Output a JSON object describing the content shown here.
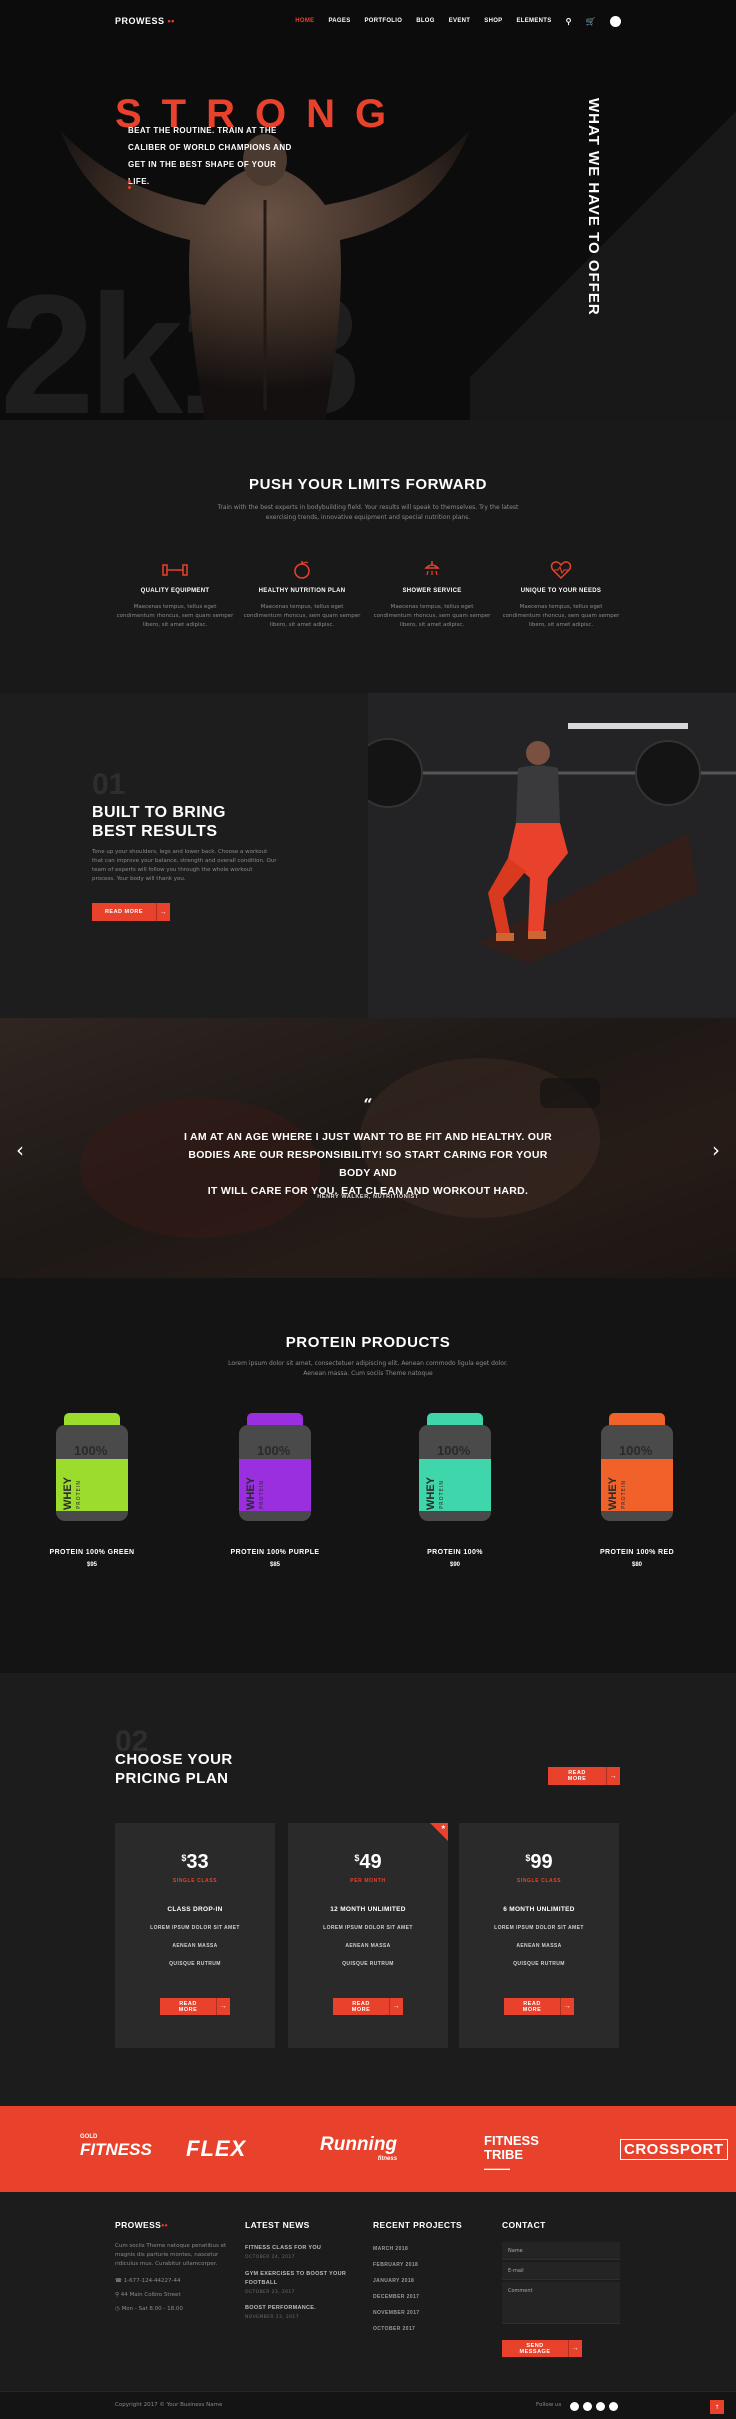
{
  "header": {
    "logo": "PROWESS",
    "logo_dots": "••",
    "menu": [
      "HOME",
      "PAGES",
      "PORTFOLIO",
      "BLOG",
      "EVENT",
      "SHOP",
      "ELEMENTS"
    ]
  },
  "hero": {
    "headline": "STRONG",
    "tagline": [
      "BEAT THE ROUTINE. TRAIN AT THE",
      "CALIBER OF WORLD CHAMPIONS AND",
      "GET IN THE BEST SHAPE OF YOUR LIFE."
    ],
    "background_text": "2k18",
    "side_text": "WHAT WE HAVE TO OFFER"
  },
  "features": {
    "title": "PUSH YOUR LIMITS FORWARD",
    "subtitle": [
      "Train with the best experts in bodybuilding field. Your results will speak to themselves. Try the latest",
      "exercising trends, innovative equipment and special nutrition plans."
    ],
    "items": [
      {
        "title": "QUALITY EQUIPMENT",
        "icon": "dumbbell-icon",
        "text": [
          "Maecenas tempus, tellus eget",
          "condimentum rhoncus, sem quam semper",
          "libero, sit amet adipisc."
        ]
      },
      {
        "title": "HEALTHY NUTRITION PLAN",
        "icon": "nutrition-icon",
        "text": [
          "Maecenas tempus, tellus eget",
          "condimentum rhoncus, sem quam semper",
          "libero, sit amet adipisc."
        ]
      },
      {
        "title": "SHOWER SERVICE",
        "icon": "shower-icon",
        "text": [
          "Maecenas tempus, tellus eget",
          "condimentum rhoncus, sem quam semper",
          "libero, sit amet adipisc."
        ]
      },
      {
        "title": "UNIQUE TO YOUR NEEDS",
        "icon": "heartbeat-icon",
        "text": [
          "Maecenas tempus, tellus eget",
          "condimentum rhoncus, sem quam semper",
          "libero, sit amet adipisc."
        ]
      }
    ]
  },
  "built": {
    "number": "01",
    "title": [
      "BUILT TO BRING",
      "BEST RESULTS"
    ],
    "text": [
      "Tone up your shoulders, legs and lower back. Choose a workout",
      "that can improve your balance, strength and overall condition. Our",
      "team of experts will follow you through the whole workout",
      "process. Your body will thank you."
    ],
    "button": "READ MORE"
  },
  "testimonial": {
    "quote_mark": "“",
    "quote": [
      "I AM AT AN AGE WHERE I JUST WANT TO BE FIT AND HEALTHY. OUR",
      "BODIES ARE OUR RESPONSIBILITY! SO START CARING FOR YOUR BODY AND",
      "IT WILL CARE FOR YOU. EAT CLEAN AND WORKOUT HARD."
    ],
    "author": "HENRY WALKER, NUTRITIONIST"
  },
  "products": {
    "title": "PROTEIN PRODUCTS",
    "subtitle": [
      "Lorem ipsum dolor sit amet, consectetuer adipiscing elit. Aenean commodo ligula eget dolor.",
      "Aenean massa. Cum sociis Theme natoque"
    ],
    "tub_pct": "100%",
    "tub_whey": "WHEY",
    "tub_protein": "PROTEIN",
    "items": [
      {
        "name": "PROTEIN 100% GREEN",
        "price": "$95",
        "color": "#9bdc2c"
      },
      {
        "name": "PROTEIN 100% PURPLE",
        "price": "$85",
        "color": "#9a2fe0"
      },
      {
        "name": "PROTEIN 100%",
        "price": "$90",
        "color": "#3fd6ab"
      },
      {
        "name": "PROTEIN 100% RED",
        "price": "$80",
        "color": "#f0622a"
      }
    ]
  },
  "pricing": {
    "number": "02",
    "title": [
      "CHOOSE YOUR",
      "PRICING PLAN"
    ],
    "button": "READ MORE",
    "cards": [
      {
        "currency": "$",
        "amount": "33",
        "period": "SINGLE CLASS",
        "plan": "CLASS DROP-IN",
        "features": [
          "LOREM IPSUM DOLOR SIT AMET",
          "AENEAN MASSA",
          "QUISQUE RUTRUM"
        ],
        "button": "READ MORE"
      },
      {
        "currency": "$",
        "amount": "49",
        "period": "PER MONTH",
        "plan": "12 MONTH UNLIMITED",
        "features": [
          "LOREM IPSUM DOLOR SIT AMET",
          "AENEAN MASSA",
          "QUISQUE RUTRUM"
        ],
        "button": "READ MORE"
      },
      {
        "currency": "$",
        "amount": "99",
        "period": "SINGLE CLASS",
        "plan": "6 MONTH UNLIMITED",
        "features": [
          "LOREM IPSUM DOLOR SIT AMET",
          "AENEAN MASSA",
          "QUISQUE RUTRUM"
        ],
        "button": "READ MORE"
      }
    ]
  },
  "brands": [
    "FITNESS",
    "FLEX",
    "Running",
    "FITNESS TRIBE",
    "CROSSPORT"
  ],
  "brand_sub": {
    "fitness_pre": "GOLD",
    "running_sub": "fitness",
    "tribe_sub": "——"
  },
  "footer": {
    "logo": "PROWESS",
    "about": [
      "Cum sociis Theme natoque penatibus et",
      "magnis dis parturie montes, nascetur",
      "ridiculus mus. Curabitur ullamcorper."
    ],
    "phone": "1-677-124-44227-44",
    "address": "44 Main Colbro Street",
    "hours": "Mon - Sat 8.00 - 18.00",
    "news_title": "LATEST NEWS",
    "news": [
      {
        "title": "FITNESS CLASS FOR YOU",
        "date": "OCTOBER 24, 2017"
      },
      {
        "title": "GYM EXERCISES TO BOOST YOUR FOOTBALL",
        "date": "OCTOBER 23, 2017"
      },
      {
        "title": "BOOST PERFORMANCE.",
        "date": "NOVEMBER 23, 2017"
      }
    ],
    "projects_title": "RECENT PROJECTS",
    "projects": [
      "MARCH 2018",
      "FEBRUARY 2018",
      "JANUARY 2018",
      "DECEMBER 2017",
      "NOVEMBER 2017",
      "OCTOBER 2017"
    ],
    "contact_title": "CONTACT",
    "contact_fields": [
      "Name",
      "E-mail",
      "Comment"
    ],
    "send_button": "SEND MESSAGE",
    "copyright": "Copyright 2017 © Your Business Name",
    "follow": "Follow us"
  },
  "colors": {
    "accent": "#e8412c",
    "background": "#141414"
  }
}
